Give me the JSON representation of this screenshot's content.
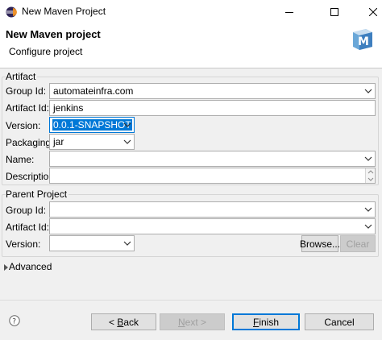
{
  "window": {
    "title": "New Maven Project",
    "minimize_icon": "minimize-icon",
    "maximize_icon": "maximize-icon",
    "close_icon": "close-icon"
  },
  "header": {
    "title": "New Maven project",
    "subtitle": "Configure project",
    "logo_text": "M"
  },
  "artifact": {
    "group_label": "Artifact",
    "group_id": {
      "label": "Group Id:",
      "value": "automateinfra.com"
    },
    "artifact_id": {
      "label": "Artifact Id:",
      "value": "jenkins"
    },
    "version": {
      "label": "Version:",
      "value": "0.0.1-SNAPSHOT"
    },
    "packaging": {
      "label": "Packaging:",
      "value": "jar"
    },
    "name": {
      "label": "Name:",
      "value": ""
    },
    "description": {
      "label": "Description:",
      "value": ""
    }
  },
  "parent": {
    "group_label": "Parent Project",
    "group_id": {
      "label": "Group Id:",
      "value": ""
    },
    "artifact_id": {
      "label": "Artifact Id:",
      "value": ""
    },
    "version": {
      "label": "Version:",
      "value": ""
    },
    "browse_label": "Browse...",
    "clear_label": "Clear"
  },
  "advanced": {
    "label": "Advanced"
  },
  "footer": {
    "help_icon": "help-icon",
    "back_prefix": "< ",
    "back_key": "B",
    "back_rest": "ack",
    "next_key": "N",
    "next_rest": "ext >",
    "finish_key": "F",
    "finish_rest": "inish",
    "cancel_label": "Cancel"
  },
  "colors": {
    "accent": "#0078d7",
    "dialog_bg": "#f0f0f0",
    "header_bg": "#ffffff"
  }
}
